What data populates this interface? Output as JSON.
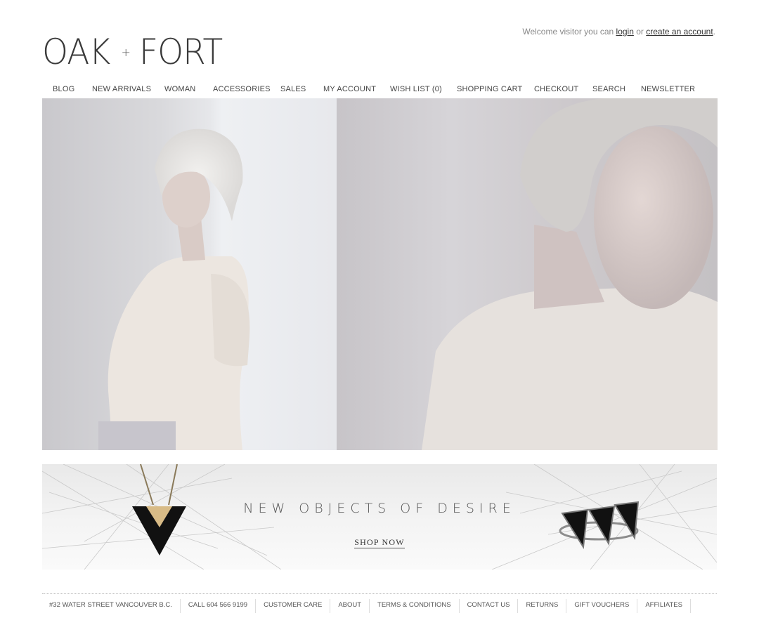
{
  "header": {
    "welcome_prefix": "Welcome visitor you can",
    "login_label": "login",
    "or_text": "or",
    "create_account_label": "create an account",
    "period": "."
  },
  "logo": {
    "left_word": "OAK",
    "plus": "+",
    "right_word": "FORT"
  },
  "nav": {
    "items": [
      "BLOG",
      "NEW ARRIVALS",
      "WOMAN",
      "ACCESSORIES",
      "SALES",
      "MY ACCOUNT",
      "WISH LIST (0)",
      "SHOPPING CART",
      "CHECKOUT",
      "SEARCH",
      "NEWSLETTER"
    ]
  },
  "promo": {
    "title": "NEW OBJECTS OF DESIRE",
    "cta": "SHOP NOW"
  },
  "footer": {
    "items": [
      "#32 WATER STREET VANCOUVER B.C.",
      "CALL 604 566 9199",
      "CUSTOMER CARE",
      "ABOUT",
      "TERMS & CONDITIONS",
      "CONTACT US",
      "RETURNS",
      "GIFT VOUCHERS",
      "AFFILIATES"
    ]
  },
  "colors": {
    "text": "#333333",
    "muted": "#888888",
    "hero_bg": "#d8d6d9",
    "promo_bg": "#f2f2f2"
  }
}
